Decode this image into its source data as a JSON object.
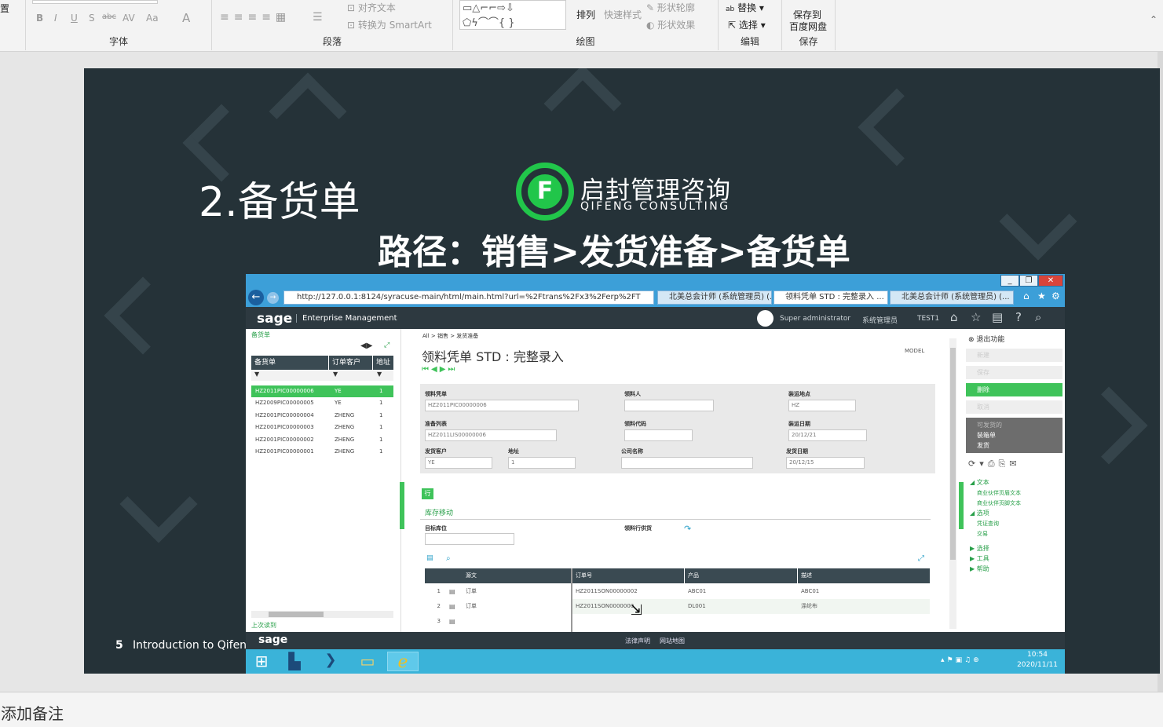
{
  "ribbon": {
    "font_group_label": "字体",
    "paragraph_group_label": "段落",
    "drawing_group_label": "绘图",
    "editing_group_label": "编辑",
    "save_group_label": "保存",
    "font_buttons": [
      "B",
      "I",
      "U",
      "S",
      "abc",
      "AV",
      "Aa",
      "A"
    ],
    "align_text": "对齐文本",
    "convert_smartart": "转换为 SmartArt",
    "arrange": "排列",
    "quick_styles": "快速样式",
    "shape_outline": "形状轮廓",
    "shape_effects": "形状效果",
    "replace": "替换",
    "select": "选择",
    "save_to_baidu_line1": "保存到",
    "save_to_baidu_line2": "百度网盘"
  },
  "slide": {
    "title": "2.备货单",
    "logo_cn": "启封管理咨询",
    "logo_en": "QIFENG CONSULTING",
    "path": "路径：销售>发货准备>备货单",
    "slide_number": "5",
    "footer_text": "Introduction to Qifeng C"
  },
  "browser": {
    "url": "http://127.0.0.1:8124/syracuse-main/html/main.html?url=%2Ftrans%2Fx3%2Ferp%2FT",
    "tabs": [
      "北美总会计师 (系统管理员) (...",
      "领料凭单 STD : 完整录入 ...",
      "北美总会计师 (系统管理员) (..."
    ]
  },
  "sage": {
    "logo": "sage",
    "product": "Enterprise Management",
    "user": "Super administrator",
    "role": "系统管理员",
    "folder": "TEST1"
  },
  "left_panel": {
    "title": "备货单",
    "columns": [
      "备货单",
      "订单客户",
      "地址"
    ],
    "rows": [
      [
        "HZ2011PIC00000006",
        "YE",
        "1"
      ],
      [
        "HZ2009PIC00000005",
        "YE",
        "1"
      ],
      [
        "HZ2001PIC00000004",
        "ZHENG",
        "1"
      ],
      [
        "HZ2001PIC00000003",
        "ZHENG",
        "1"
      ],
      [
        "HZ2001PIC00000002",
        "ZHENG",
        "1"
      ],
      [
        "HZ2001PIC00000001",
        "ZHENG",
        "1"
      ]
    ],
    "last_read": "上次读到"
  },
  "main": {
    "breadcrumb": "All >  销售 >  发货准备",
    "title": "领料凭单 STD : 完整录入",
    "model": "MODEL",
    "fields": {
      "voucher_label": "领料凭单",
      "voucher_value": "HZ2011PIC00000006",
      "picker_label": "领料人",
      "picker_value": "",
      "ship_site_label": "装运地点",
      "ship_site_value": "HZ",
      "prep_list_label": "准备列表",
      "prep_list_value": "HZ2011LIS00000006",
      "picker_code_label": "领料代码",
      "picker_code_value": "",
      "ship_date_label": "装运日期",
      "ship_date_value": "20/12/21",
      "customer_label": "发货客户",
      "customer_value": "YE",
      "address_label": "地址",
      "address_value": "1",
      "company_label": "公司名称",
      "company_value": "",
      "delivery_date_label": "发货日期",
      "delivery_date_value": "20/12/15"
    },
    "lines_tab": "行",
    "stock_section": "库存移动",
    "target_loc_label": "目标库位",
    "line_supply_label": "领料行供货",
    "grid_columns": [
      "源文",
      "订单号",
      "产品",
      "描述"
    ],
    "grid_rows": [
      {
        "num": "1",
        "src": "订单",
        "order": "HZ2011SON00000002",
        "product": "ABC01",
        "desc": "ABC01"
      },
      {
        "num": "2",
        "src": "订单",
        "order": "HZ2011SON0000000",
        "product": "DL001",
        "desc": "涤纶布"
      },
      {
        "num": "3",
        "src": "",
        "order": "",
        "product": "",
        "desc": ""
      }
    ]
  },
  "right_panel": {
    "exit": "退出功能",
    "new": "新建",
    "save": "保存",
    "delete": "删除",
    "cancel": "取消",
    "shippable_1": "可发货的",
    "shippable_2": "装箱单",
    "shippable_3": "发货",
    "text_section": "文本",
    "text_link1": "商业伙伴页眉文本",
    "text_link2": "商业伙伴页脚文本",
    "options_section": "选项",
    "opt_link1": "凭证查询",
    "opt_link2": "交易",
    "select": "选择",
    "tools": "工具",
    "help": "帮助"
  },
  "sage_footer": {
    "logo": "sage",
    "legal": "法律声明",
    "sitemap": "网站地图"
  },
  "taskbar": {
    "time": "10:54",
    "date": "2020/11/11"
  },
  "notes": {
    "placeholder": "添加备注"
  },
  "colors": {
    "slide_bg": "#253238",
    "sage_green": "#21c64a",
    "ie_blue": "#3c9fd8"
  }
}
